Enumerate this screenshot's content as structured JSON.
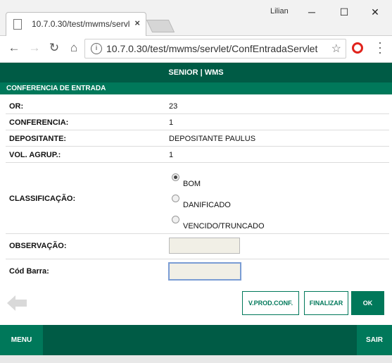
{
  "browser": {
    "tab_title": "10.7.0.30/test/mwms/servlet/ConfEntradaServlet",
    "tab_close": "×",
    "user": "Lilian",
    "url": "10.7.0.30/test/mwms/servlet/ConfEntradaServlet",
    "minimize": "─",
    "maximize": "☐",
    "close": "✕"
  },
  "app": {
    "header_title": "SENIOR | WMS",
    "section_title": "CONFERENCIA DE ENTRADA",
    "fields": [
      {
        "label": "OR:",
        "value": "23"
      },
      {
        "label": "CONFERENCIA:",
        "value": "1"
      },
      {
        "label": "DEPOSITANTE:",
        "value": "DEPOSITANTE PAULUS"
      },
      {
        "label": "VOL. AGRUP.:",
        "value": "1"
      }
    ],
    "classificacao": {
      "label": "CLASSIFICAÇÃO:",
      "options": [
        "BOM",
        "DANIFICADO",
        "VENCIDO/TRUNCADO"
      ],
      "selected": "BOM"
    },
    "observacao": {
      "label": "OBSERVAÇÃO:",
      "value": ""
    },
    "cod_barra": {
      "label": "Cód Barra:",
      "value": ""
    },
    "buttons": {
      "vprod": "V.PROD.CONF.",
      "finalizar": "FINALIZAR",
      "ok": "OK"
    },
    "footer": {
      "menu": "MENU",
      "sair": "SAIR"
    }
  },
  "colors": {
    "dark_green": "#005b45",
    "green": "#00785a"
  }
}
